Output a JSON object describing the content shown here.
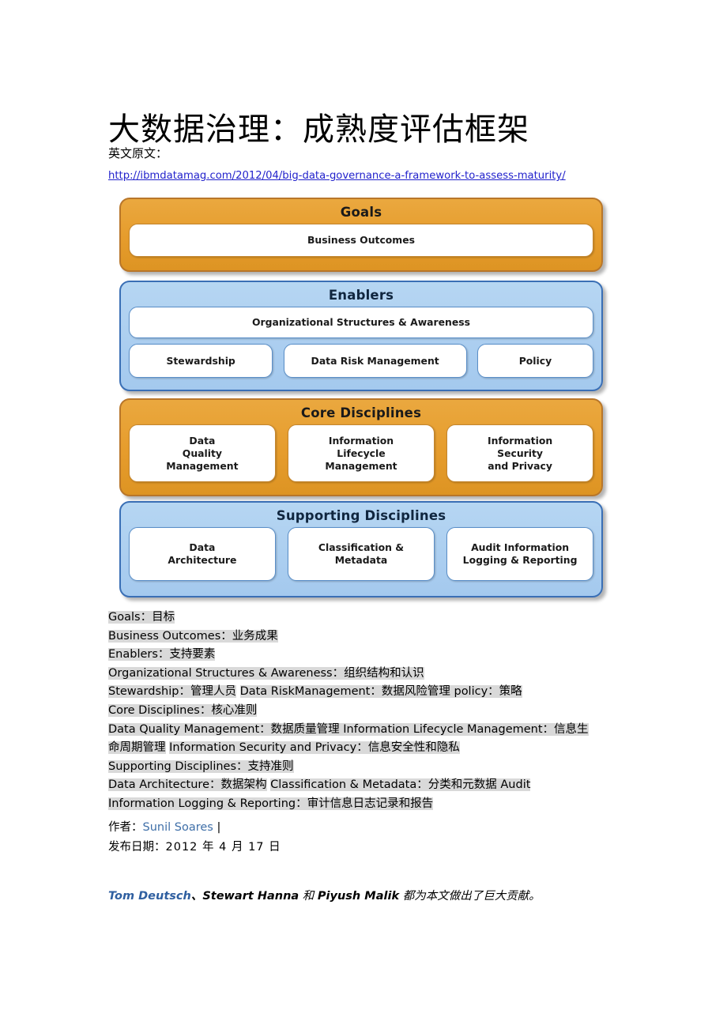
{
  "document": {
    "title": "大数据治理：成熟度评估框架",
    "source_label": "英文原文：",
    "source_url": "http://ibmdatamag.com/2012/04/big-data-governance-a-framework-to-assess-maturity/"
  },
  "colors": {
    "orange_fill": "#e69c2c",
    "orange_border": "#b8762a",
    "blue_fill": "#abcef0",
    "blue_border": "#3a6fb5",
    "cell_fill": "#ffffff",
    "link_blue": "#2222cc",
    "author_blue": "#3f6fa8",
    "highlight_gray": "#d9d9d9"
  },
  "diagram": {
    "bands": [
      {
        "id": "goals",
        "title": "Goals",
        "style": "orange",
        "rows": [
          {
            "cells": [
              "Business Outcomes"
            ]
          }
        ]
      },
      {
        "id": "enablers",
        "title": "Enablers",
        "style": "blue",
        "rows": [
          {
            "cells": [
              "Organizational Structures & Awareness"
            ]
          },
          {
            "cells": [
              "Stewardship",
              "Data Risk Management",
              "Policy"
            ]
          }
        ]
      },
      {
        "id": "core",
        "title": "Core Disciplines",
        "style": "orange",
        "rows": [
          {
            "cells": [
              "Data\nQuality\nManagement",
              "Information\nLifecycle\nManagement",
              "Information\nSecurity\nand Privacy"
            ]
          }
        ]
      },
      {
        "id": "support",
        "title": "Supporting Disciplines",
        "style": "blue",
        "rows": [
          {
            "cells": [
              "Data\nArchitecture",
              "Classification &\nMetadata",
              "Audit Information\nLogging & Reporting"
            ]
          }
        ]
      }
    ]
  },
  "glossary": {
    "lines": [
      [
        {
          "text": "Goals：目标",
          "highlight": true
        }
      ],
      [
        {
          "text": "Business Outcomes：业务成果",
          "highlight": true
        }
      ],
      [
        {
          "text": "Enablers：支持要素",
          "highlight": true
        }
      ],
      [
        {
          "text": "Organizational Structures & Awareness：组织结构和认识",
          "highlight": true
        }
      ],
      [
        {
          "text": "Stewardship：管理人员",
          "highlight": true
        },
        {
          "text": "    ",
          "highlight": false
        },
        {
          "text": "Data RiskManagement：数据风险管理",
          "highlight": true
        },
        {
          "text": "  ",
          "highlight": true
        },
        {
          "text": "policy：策略",
          "highlight": true
        }
      ],
      [
        {
          "text": "Core Disciplines：核心准则",
          "highlight": true
        }
      ],
      [
        {
          "text": "Data Quality Management：数据质量管理",
          "highlight": true
        },
        {
          "text": "    ",
          "highlight": true
        },
        {
          "text": "Information Lifecycle Management：信息生命周期管理",
          "highlight": true
        },
        {
          "text": "  ",
          "highlight": false
        },
        {
          "text": "Information Security and Privacy：信息安全性和隐私",
          "highlight": true
        }
      ],
      [
        {
          "text": "Supporting Disciplines：支持准则",
          "highlight": true
        }
      ],
      [
        {
          "text": "Data Architecture：数据架构",
          "highlight": true
        },
        {
          "text": "   ",
          "highlight": false
        },
        {
          "text": "Classification & Metadata：分类和元数据",
          "highlight": true
        },
        {
          "text": "    ",
          "highlight": true
        },
        {
          "text": "Audit Information Logging & Reporting：审计信息日志记录和报告",
          "highlight": true
        }
      ]
    ]
  },
  "byline": {
    "author_label": "作者：",
    "author_name": "Sunil Soares",
    "author_separator": "|",
    "date_label": "发布日期：",
    "date_value": "2012 年 4 月 17 日"
  },
  "credits": {
    "name_blue": "Tom Deutsch",
    "separator_1": "、",
    "name_2": "Stewart Hanna",
    "conjunction": " 和 ",
    "name_3": "Piyush Malik",
    "tail": " 都为本文做出了巨大贡献。"
  }
}
